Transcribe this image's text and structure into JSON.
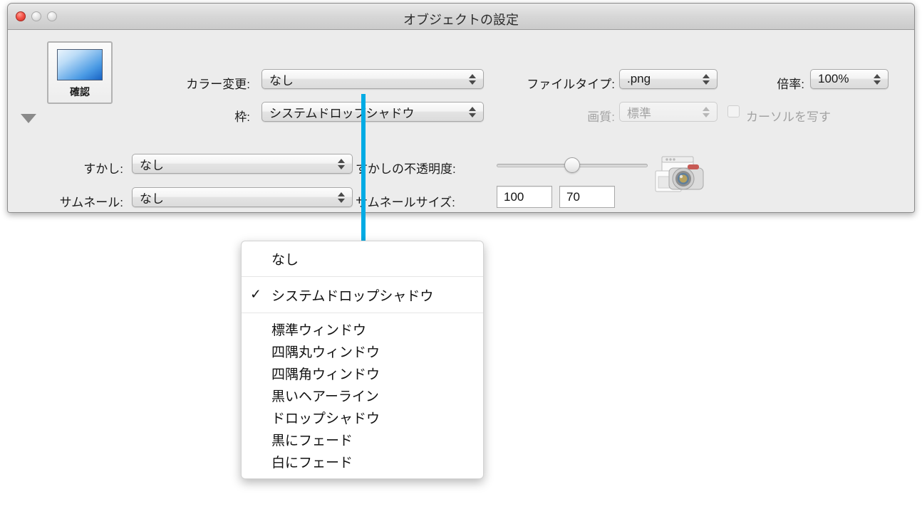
{
  "window": {
    "title": "オブジェクトの設定",
    "traffic_lights": [
      {
        "name": "close",
        "state": "active",
        "color": "#f5564b"
      },
      {
        "name": "minimize",
        "state": "disabled",
        "color": "#e4e4e4"
      },
      {
        "name": "zoom",
        "state": "disabled",
        "color": "#e4e4e4"
      }
    ]
  },
  "preview": {
    "label": "確認",
    "swatch_color": "#2d7fd8"
  },
  "fields": {
    "color_change": {
      "label": "カラー変更:",
      "value": "なし"
    },
    "frame": {
      "label": "枠:",
      "value": "システムドロップシャドウ"
    },
    "file_type": {
      "label": "ファイルタイプ:",
      "value": ".png"
    },
    "quality": {
      "label": "画質:",
      "value": "標準",
      "disabled": true
    },
    "scale": {
      "label": "倍率:",
      "value": "100%"
    },
    "capture_cursor": {
      "label": "カーソルを写す",
      "checked": false,
      "disabled": true
    },
    "watermark": {
      "label": "すかし:",
      "value": "なし"
    },
    "watermark_opacity": {
      "label": "すかしの不透明度:",
      "value": 50
    },
    "thumbnail": {
      "label": "サムネール:",
      "value": "なし"
    },
    "thumbnail_size": {
      "label": "サムネールサイズ:",
      "width": "100",
      "height": "70"
    }
  },
  "camera_icon": "camera-icon",
  "connector": {
    "color": "#00abe4"
  },
  "menu": {
    "items": [
      {
        "label": "なし",
        "checked": false,
        "separator_after": true
      },
      {
        "label": "システムドロップシャドウ",
        "checked": true,
        "separator_after": true
      },
      {
        "label": "標準ウィンドウ",
        "checked": false,
        "separator_after": false
      },
      {
        "label": "四隅丸ウィンドウ",
        "checked": false,
        "separator_after": false
      },
      {
        "label": "四隅角ウィンドウ",
        "checked": false,
        "separator_after": false
      },
      {
        "label": "黒いヘアーライン",
        "checked": false,
        "separator_after": false
      },
      {
        "label": "ドロップシャドウ",
        "checked": false,
        "separator_after": false
      },
      {
        "label": "黒にフェード",
        "checked": false,
        "separator_after": false
      },
      {
        "label": "白にフェード",
        "checked": false,
        "separator_after": false
      }
    ],
    "checkmark_glyph": "✓"
  }
}
